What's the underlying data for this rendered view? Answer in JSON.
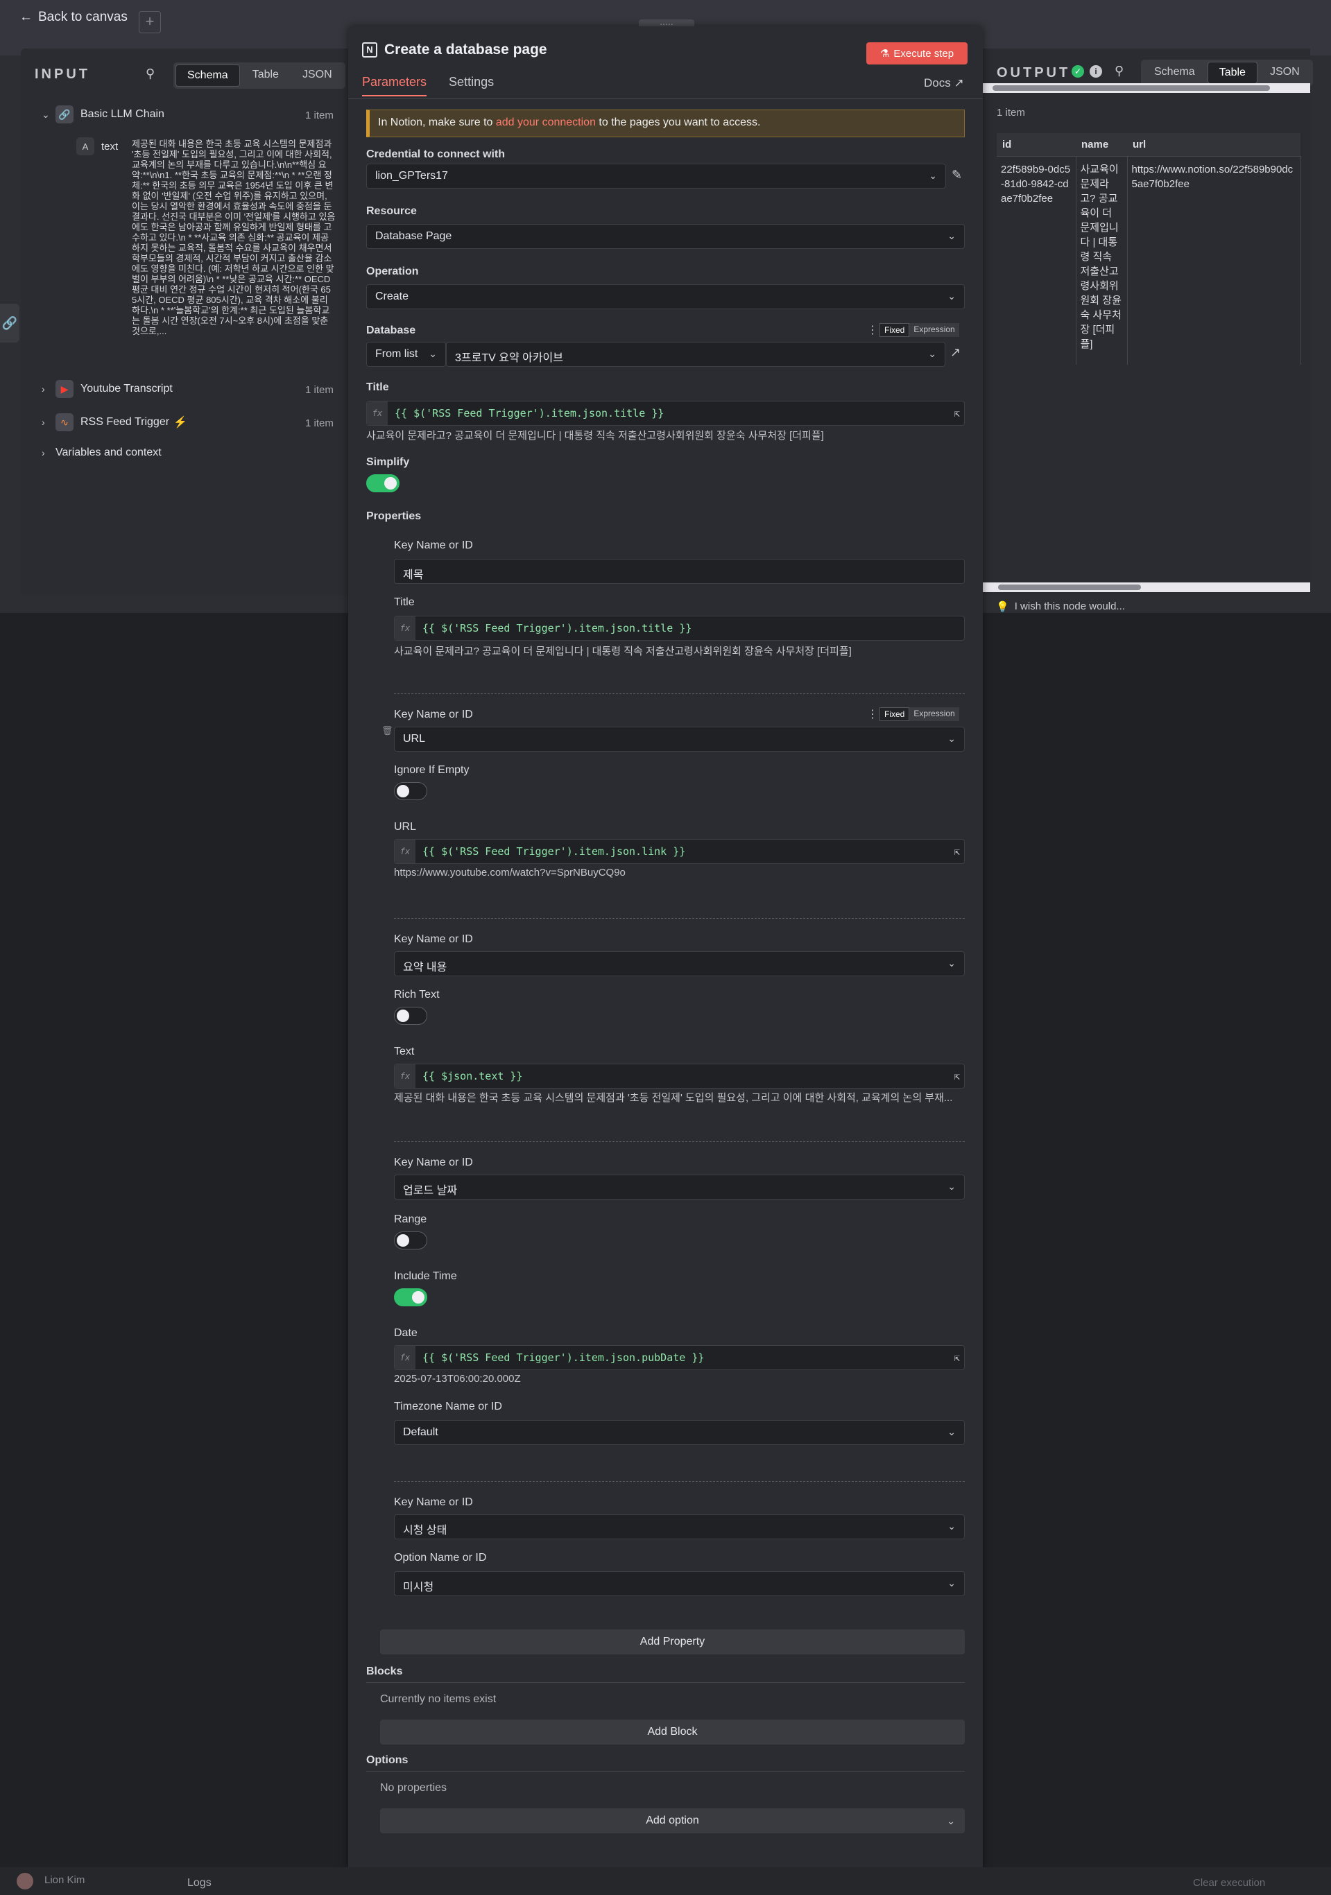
{
  "canvas": {
    "back_label": "Back to canvas",
    "add_label": "+",
    "handle_label": ":::::"
  },
  "input": {
    "title": "INPUT",
    "view_tabs": [
      "Schema",
      "Table",
      "JSON"
    ],
    "nodes": [
      {
        "name": "Basic LLM Chain",
        "count": "1 item"
      },
      {
        "name": "Youtube Transcript",
        "count": "1 item"
      },
      {
        "name": "RSS Feed Trigger",
        "count": "1 item"
      }
    ],
    "field_type": "A",
    "field_key": "text",
    "field_value": "제공된 대화 내용은 한국 초등 교육 시스템의 문제점과 '초등 전일제' 도입의 필요성, 그리고 이에 대한 사회적, 교육계의 논의 부재를 다루고 있습니다.\\n\\n**핵심 요약:**\\n\\n1. **한국 초등 교육의 문제점:**\\n * **오랜 정체:** 한국의 초등 의무 교육은 1954년 도입 이후 큰 변화 없이 '반일제' (오전 수업 위주)를 유지하고 있으며, 이는 당시 열악한 환경에서 효율성과 속도에 중점을 둔 결과다. 선진국 대부분은 이미 '전일제'를 시행하고 있음에도 한국은 남아공과 함께 유일하게 반일제 형태를 고수하고 있다.\\n * **사교육 의존 심화:** 공교육이 제공하지 못하는 교육적, 돌봄적 수요를 사교육이 채우면서 학부모들의 경제적, 시간적 부담이 커지고 출산율 감소에도 영향을 미친다. (예: 저학년 하교 시간으로 인한 맞벌이 부부의 어려움)\\n * **낮은 공교육 시간:** OECD 평균 대비 연간 정규 수업 시간이 현저히 적어(한국 655시간, OECD 평균 805시간), 교육 격차 해소에 불리하다.\\n * **'늘봄학교'의 한계:** 최근 도입된 늘봄학교는 돌봄 시간 연장(오전 7시~오후 8시)에 초점을 맞춘 것으로,...",
    "variables_label": "Variables and context"
  },
  "modal": {
    "title": "Create a database page",
    "execute_label": "Execute step",
    "tabs": [
      "Parameters",
      "Settings"
    ],
    "docs_label": "Docs",
    "notice_pre": "In Notion, make sure to ",
    "notice_link": "add your connection",
    "notice_post": " to the pages you want to access.",
    "credential_label": "Credential to connect with",
    "credential_value": "lion_GPTers17",
    "resource_label": "Resource",
    "resource_value": "Database Page",
    "operation_label": "Operation",
    "operation_value": "Create",
    "database_label": "Database",
    "fixed_label": "Fixed",
    "expression_label": "Expression",
    "database_mode": "From list",
    "database_value": "3프로TV 요약 아카이브",
    "title_label": "Title",
    "title_expr": "{{ $('RSS Feed Trigger').item.json.title }}",
    "title_preview": "사교육이 문제라고? 공교육이 더 문제입니다 | 대통령 직속 저출산고령사회위원회 장윤숙 사무처장 [더피플]",
    "simplify_label": "Simplify",
    "properties_label": "Properties",
    "key_label": "Key Name or ID",
    "prop1_key": "제목",
    "prop1_field_label": "Title",
    "prop1_expr": "{{ $('RSS Feed Trigger').item.json.title }}",
    "prop1_preview": "사교육이 문제라고? 공교육이 더 문제입니다 | 대통령 직속 저출산고령사회위원회 장윤숙 사무처장 [더피플]",
    "prop2_key": "URL",
    "ignore_label": "Ignore If Empty",
    "prop2_field_label": "URL",
    "prop2_expr": "{{ $('RSS Feed Trigger').item.json.link }}",
    "prop2_preview": "https://www.youtube.com/watch?v=SprNBuyCQ9o",
    "prop3_key": "요약 내용",
    "richtext_label": "Rich Text",
    "prop3_field_label": "Text",
    "prop3_expr": "{{ $json.text }}",
    "prop3_preview": "제공된 대화 내용은 한국 초등 교육 시스템의 문제점과 '초등 전일제' 도입의 필요성, 그리고 이에 대한 사회적, 교육계의 논의 부재...",
    "prop4_key": "업로드 날짜",
    "range_label": "Range",
    "include_time_label": "Include Time",
    "date_label": "Date",
    "prop4_expr": "{{ $('RSS Feed Trigger').item.json.pubDate }}",
    "prop4_preview": "2025-07-13T06:00:20.000Z",
    "timezone_label": "Timezone Name or ID",
    "timezone_value": "Default",
    "prop5_key": "시청 상태",
    "option_label": "Option Name or ID",
    "option_value": "미시청",
    "add_property": "Add Property",
    "blocks_label": "Blocks",
    "no_items": "Currently no items exist",
    "add_block": "Add Block",
    "options_label": "Options",
    "no_properties": "No properties",
    "add_option": "Add option"
  },
  "output": {
    "title": "OUTPUT",
    "view_tabs": [
      "Schema",
      "Table",
      "JSON"
    ],
    "count": "1 item",
    "columns": [
      "id",
      "name",
      "url"
    ],
    "row": {
      "id": "22f589b9-0dc5-81d0-9842-cdae7f0b2fee",
      "name": "사교육이 문제라고? 공교육이 더 문제입니다 | 대통령 직속 저출산고령사회위원회 장윤숙 사무처장 [더피플]",
      "url": "https://www.notion.so/22f589b90dc5ae7f0b2fee"
    },
    "wish_label": "I wish this node would..."
  },
  "bottom": {
    "user": "Lion Kim",
    "logs": "Logs",
    "clear": "Clear execution"
  }
}
